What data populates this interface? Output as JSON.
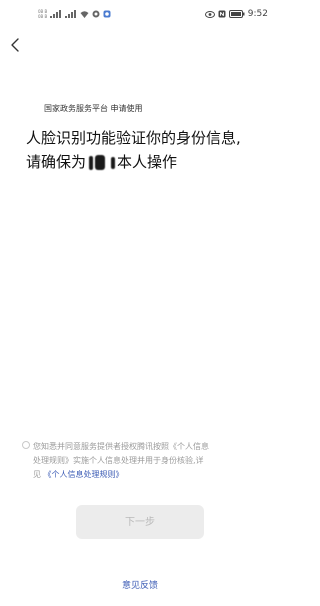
{
  "status_bar": {
    "carrier_top": "0B B",
    "carrier_bottom": "0B B",
    "time": "9:52"
  },
  "nav": {
    "back_icon": "chevron-left-icon"
  },
  "header": {
    "platform_line": "国家政务服务平台 申请使用"
  },
  "main": {
    "headline_line1": "人脸识别功能验证你的身份信息,",
    "headline_line2_prefix": "请确保为",
    "headline_line2_suffix": "本人操作"
  },
  "agreement": {
    "line1": "您知悉并同意服务提供者授权腾讯按照《个人信息",
    "line2": "处理规则》实施个人信息处理并用于身份核验,详",
    "line3_prefix": "见",
    "link_text": "《个人信息处理规则》"
  },
  "actions": {
    "next_label": "下一步",
    "feedback_label": "意见反馈"
  }
}
